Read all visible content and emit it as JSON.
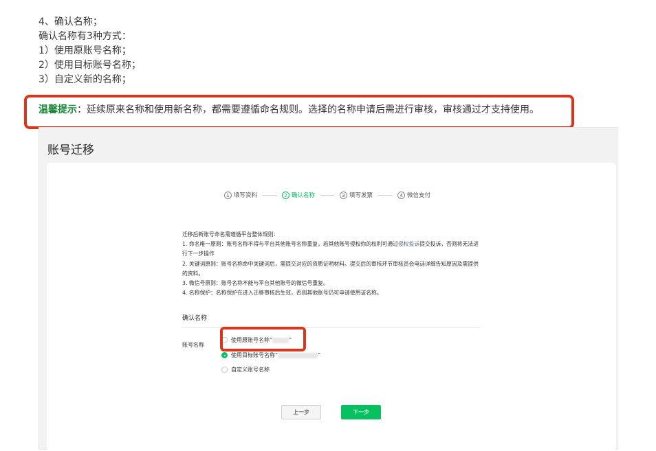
{
  "doc": {
    "lines": [
      "4、确认名称；",
      "确认名称有3种方式：",
      "1）使用原账号名称；",
      "2）使用目标账号名称；",
      "3）自定义新的名称；"
    ],
    "tip_label": "温馨提示",
    "tip_text": "：延续原来名称和使用新名称，都需要遵循命名规则。选择的名称申请后需进行审核，审核通过才支持使用。"
  },
  "screenshot": {
    "title": "账号迁移",
    "steps": [
      {
        "num": "1",
        "label": "填写资料"
      },
      {
        "num": "2",
        "label": "确认名称"
      },
      {
        "num": "3",
        "label": "填写发票"
      },
      {
        "num": "4",
        "label": "微信支付"
      }
    ],
    "active_step": 2,
    "rules": {
      "heading": "迁移后新账号命名需遵循平台整体规则：",
      "r1_a": "1. 命名唯一原则：账号名称不得与平台其他账号名称重复，若其他账号侵权你的权利可通过",
      "r1_link": "侵权投诉",
      "r1_b": "提交投诉，否则将无法进行下一步操作",
      "r2": "2. 关键词原则：账号名称命中关键词后，需提交对应的资质证明材料。提交后的审核环节审核员会电话详细告知原因及需提供的资料。",
      "r3": "3. 微信号原则：账号名称不能与平台其他账号的微信号重复。",
      "r4": "4. 名称保护：名称保护在进入迁移审核后生效，否则其他账号仍可申请使用该名称。"
    },
    "section_title": "确认名称",
    "field_label": "账号名称",
    "options": [
      {
        "label": "使用原账号名称“",
        "suffix": "”",
        "checked": false
      },
      {
        "label": "使用目标账号名称“",
        "suffix": "”",
        "checked": true
      },
      {
        "label": "自定义账号名称",
        "suffix": "",
        "checked": false
      }
    ],
    "prev_label": "上一步",
    "next_label": "下一步"
  },
  "colors": {
    "accent": "#07c160",
    "highlight": "#d9341c",
    "tip_label": "#1a8a3a"
  }
}
